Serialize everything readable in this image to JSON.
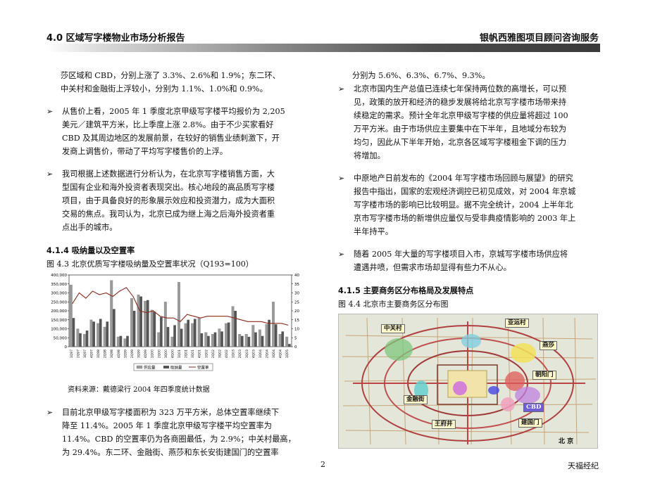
{
  "header": {
    "left": "4.0 区域写字楼物业市场分析报告",
    "right": "银帆西雅图项目顾问咨询服务"
  },
  "left": {
    "p0_l1": "莎区域和 CBD，分别上涨了 3.3%、2.6%和 1.9%；东二环、",
    "p0_l2": "中关村和金融街上浮较小，分别为 1.1%、1.0%和 0.9%。",
    "b1": [
      "从售价上看，2005 年 1 季度北京甲级写字楼平均报价为 2,205",
      "美元／建筑平方米，比上季度上涨 2.8%。由于不少买家看好",
      "CBD 及其周边地区的发展前景，在较好的销售业绩刺激下，开",
      "发商上调售价，带动了平均写字楼售价的上浮。"
    ],
    "b2": [
      "我司根据上述数据进行分析认为，在北京写字楼销售方面，大",
      "型国有企业和海外投资者表现突出。核心地段的高品质写字楼",
      "项目，由于具备良好的形象展示效应和投资潜力，成为大面积",
      "交易的焦点。我司认为，北京已成为继上海之后海外投资者重",
      "点出手的城市。"
    ],
    "section": "4.1.4 吸纳量以及空置率",
    "caption": "图 4.3 北京优质写字楼吸纳量及空置率状况（Q193=100）",
    "source": "资料来源：戴德梁行 2004 年四季度统计数据",
    "b3": [
      "目前北京甲级写字楼面积为 323 万平方米，总体空置率继续下",
      "降至 11.4%。2005 年 1 季度北京甲级写字楼平均空置率为",
      "11.4%。CBD 的空置率仍为各商圈最低，为 2.9%；中关村最高，",
      "为 29.4%。东二环、金融街、燕莎和东长安街建国门的空置率"
    ]
  },
  "right": {
    "p0": "分别为 5.6%、6.3%、6.7%、9.3%。",
    "b1": [
      "北京市国内生产总值已连续七年保持两位数的高增长，可以预",
      "见，政策的放开和经济的稳步发展将给北京写字楼市场带来持",
      "续稳定的需求。预计全年北京甲级写字楼的供应量将超过 100",
      "万平方米。由于市场供应主要集中在下半年，且地域分布较为",
      "均匀，因此从下半年开始，北京各区域写字楼租金下调的压力",
      "将增加。"
    ],
    "b2": [
      "中原地产日前发布的《2004 年写字楼市场回顾与展望》的研究",
      "报告中指出，国家的宏观经济调控已初见成效，对 2004 年京城",
      "写字楼市场的影响已比较明显。据不完全统计，2004 上半年北",
      "京市写字楼市场的新增供应量仅与受非典疫情影响的 2003 年上",
      "半年持平。"
    ],
    "b3": [
      "随着 2005 年大量的写字楼项目入市，京城写字楼市场供应将",
      "遭遇井喷，但需求市场却显得有些力不从心。"
    ],
    "section": "4.1.5 主要商务区分布格局及发展特点",
    "caption": "图 4.4 北京市主要商务区分布图"
  },
  "map_labels": {
    "zgc": "中关村",
    "yyc": "亚运村",
    "ys": "燕莎",
    "cym": "朝阳门",
    "jrj": "金融街",
    "cbd": "CBD",
    "jgm": "建国门",
    "wfj": "王府井",
    "bj": "北 京"
  },
  "bullet_mark": "➢",
  "footer": {
    "page": "2",
    "right": "天福经纪"
  },
  "chart_data": {
    "type": "bar",
    "yleft": {
      "min": 0,
      "max": 400000,
      "ticks": [
        "0",
        "50,000",
        "100,000",
        "150,000",
        "200,000",
        "250,000",
        "300,000",
        "350,000",
        "400,000"
      ]
    },
    "yright": {
      "min": 0,
      "max": 40,
      "ticks": [
        "0",
        "5",
        "10",
        "15",
        "20",
        "25",
        "30",
        "35",
        "40"
      ]
    },
    "categories": [
      "1Q97",
      "2Q97",
      "3Q97",
      "4Q97",
      "1Q98",
      "2Q98",
      "3Q98",
      "4Q98",
      "1Q99",
      "2Q99",
      "3Q99",
      "4Q99",
      "1Q00",
      "2Q00",
      "3Q00",
      "4Q00",
      "1Q01",
      "2Q01",
      "3Q01",
      "4Q01",
      "1Q02",
      "2Q02",
      "3Q02",
      "4Q02",
      "1Q03",
      "2Q03",
      "3Q03",
      "4Q03",
      "1Q04",
      "2Q04",
      "3Q04",
      "4Q04",
      "1Q05"
    ],
    "series": [
      {
        "name": "供应量",
        "type": "bar",
        "axis": "left",
        "color": "#9a9a9a",
        "values": [
          345000,
          100000,
          70000,
          150000,
          130000,
          110000,
          370000,
          55000,
          45000,
          270000,
          290000,
          255000,
          205000,
          80000,
          250000,
          55000,
          360000,
          130000,
          130000,
          160000,
          80000,
          70000,
          100000,
          130000,
          225000,
          70000,
          70000,
          120000,
          95000,
          125000,
          250000,
          70000,
          55000
        ]
      },
      {
        "name": "吸纳量",
        "type": "bar",
        "axis": "left",
        "color": "#555555",
        "values": [
          160000,
          75000,
          90000,
          140000,
          155000,
          140000,
          210000,
          60000,
          60000,
          200000,
          280000,
          260000,
          195000,
          165000,
          110000,
          120000,
          100000,
          150000,
          155000,
          75000,
          60000,
          80000,
          85000,
          135000,
          200000,
          60000,
          55000,
          80000,
          60000,
          150000,
          125000,
          85000,
          15000
        ]
      },
      {
        "name": "空置率",
        "type": "line",
        "axis": "right",
        "color": "#8b2a1a",
        "values": [
          24,
          30,
          27,
          31,
          29,
          30,
          28,
          31,
          33,
          28,
          20,
          19,
          20,
          17,
          16,
          16,
          14,
          18,
          17,
          16,
          17,
          17,
          17,
          17,
          16,
          15,
          14,
          14,
          14,
          13,
          13,
          13,
          12
        ]
      }
    ]
  }
}
